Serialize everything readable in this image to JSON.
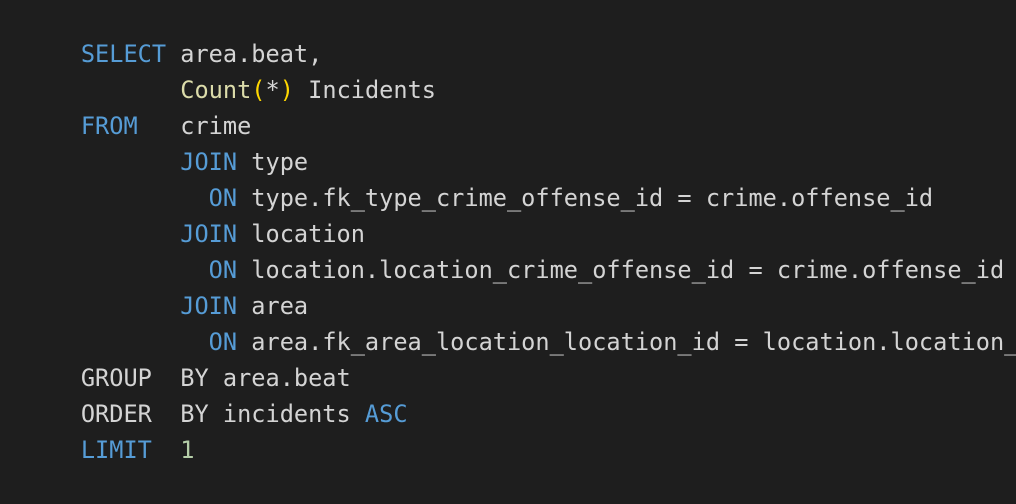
{
  "colors": {
    "background": "#1e1e1e",
    "keyword": "#569cd6",
    "plain": "#d4d4d4",
    "function": "#dcdcaa",
    "paren": "#ffd700",
    "number": "#b5cea8"
  },
  "code": {
    "lines": [
      {
        "tokens": [
          {
            "t": "SELECT",
            "k": "kw"
          },
          {
            "t": " area.beat,",
            "k": "plain"
          }
        ]
      },
      {
        "tokens": [
          {
            "t": "       ",
            "k": "plain"
          },
          {
            "t": "Count",
            "k": "fn"
          },
          {
            "t": "(",
            "k": "paren"
          },
          {
            "t": "*",
            "k": "plain"
          },
          {
            "t": ")",
            "k": "paren"
          },
          {
            "t": " Incidents",
            "k": "plain"
          }
        ]
      },
      {
        "tokens": [
          {
            "t": "FROM",
            "k": "kw"
          },
          {
            "t": "   crime",
            "k": "plain"
          }
        ]
      },
      {
        "tokens": [
          {
            "t": "       ",
            "k": "plain"
          },
          {
            "t": "JOIN",
            "k": "kw"
          },
          {
            "t": " type",
            "k": "plain"
          }
        ]
      },
      {
        "tokens": [
          {
            "t": "         ",
            "k": "plain"
          },
          {
            "t": "ON",
            "k": "kw"
          },
          {
            "t": " type.fk_type_crime_offense_id = crime.offense_id",
            "k": "plain"
          }
        ]
      },
      {
        "tokens": [
          {
            "t": "       ",
            "k": "plain"
          },
          {
            "t": "JOIN",
            "k": "kw"
          },
          {
            "t": " location",
            "k": "plain"
          }
        ]
      },
      {
        "tokens": [
          {
            "t": "         ",
            "k": "plain"
          },
          {
            "t": "ON",
            "k": "kw"
          },
          {
            "t": " location.location_crime_offense_id = crime.offense_id",
            "k": "plain"
          }
        ]
      },
      {
        "tokens": [
          {
            "t": "       ",
            "k": "plain"
          },
          {
            "t": "JOIN",
            "k": "kw"
          },
          {
            "t": " area",
            "k": "plain"
          }
        ]
      },
      {
        "tokens": [
          {
            "t": "         ",
            "k": "plain"
          },
          {
            "t": "ON",
            "k": "kw"
          },
          {
            "t": " area.fk_area_location_location_id = location.location_id",
            "k": "plain"
          }
        ]
      },
      {
        "tokens": [
          {
            "t": "GROUP  BY area.beat",
            "k": "plain"
          }
        ]
      },
      {
        "tokens": [
          {
            "t": "ORDER  BY incidents ",
            "k": "plain"
          },
          {
            "t": "ASC",
            "k": "kw"
          }
        ]
      },
      {
        "tokens": [
          {
            "t": "LIMIT",
            "k": "kw"
          },
          {
            "t": "  ",
            "k": "plain"
          },
          {
            "t": "1",
            "k": "num"
          }
        ]
      }
    ]
  }
}
